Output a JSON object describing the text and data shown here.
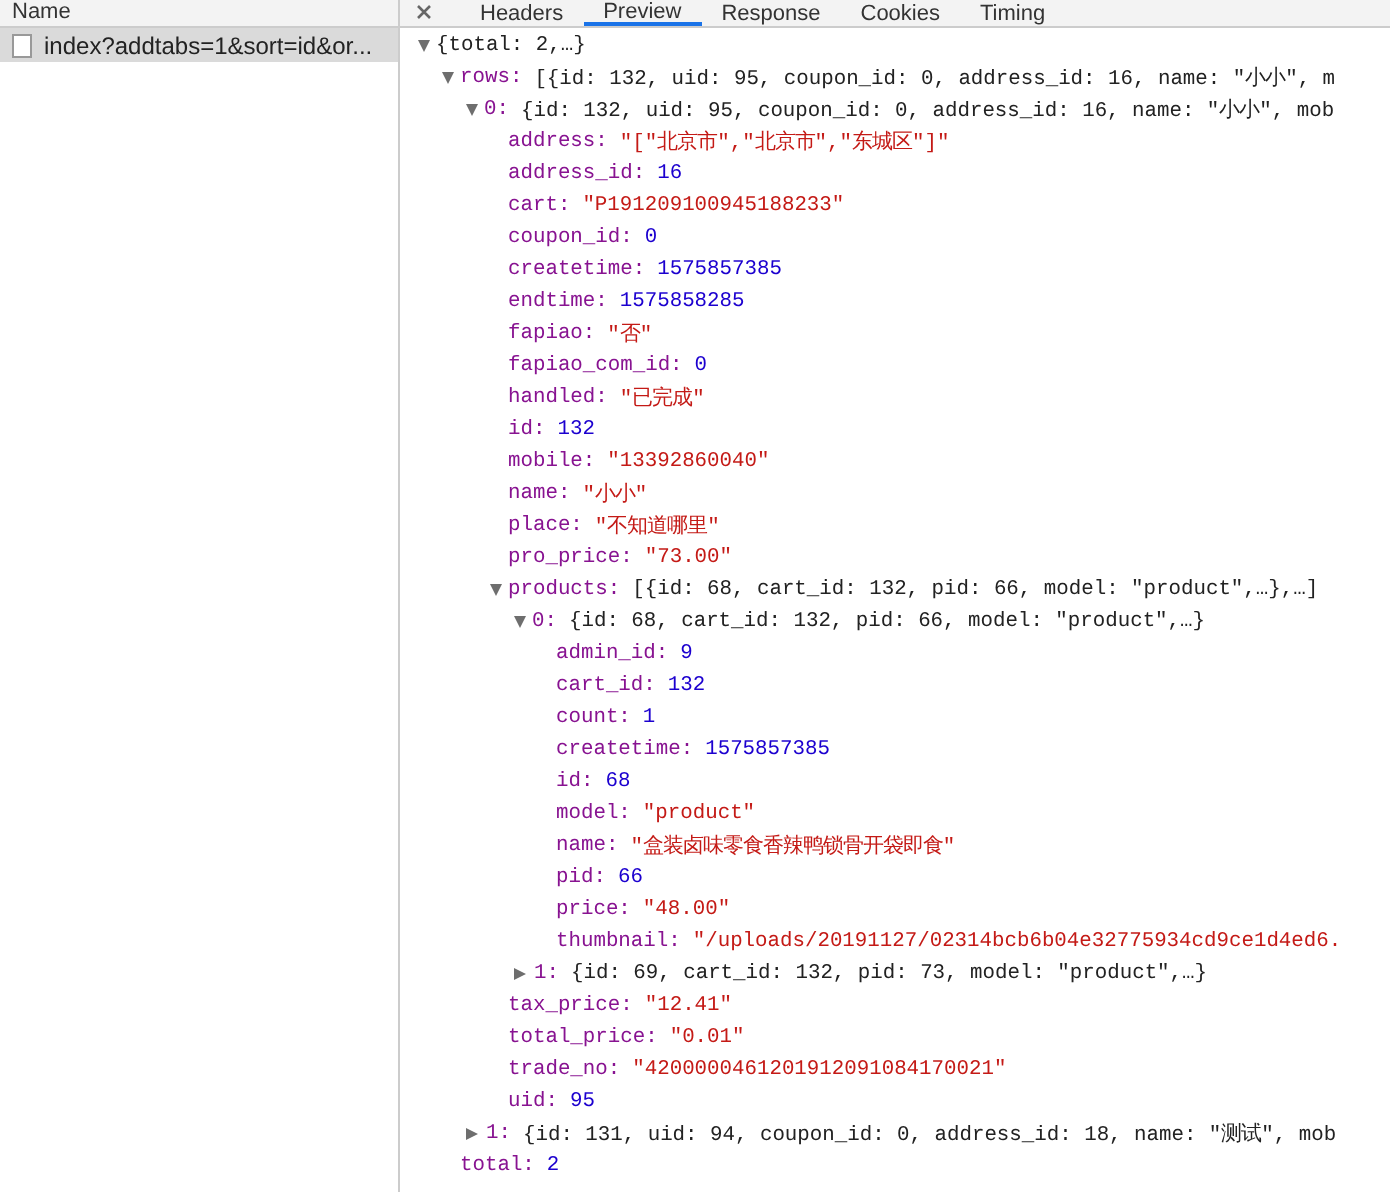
{
  "requests": {
    "header": "Name",
    "items": [
      {
        "label": "index?addtabs=1&sort=id&or...",
        "selected": true
      }
    ]
  },
  "tabs": [
    {
      "label": "Headers",
      "selected": false
    },
    {
      "label": "Preview",
      "selected": true
    },
    {
      "label": "Response",
      "selected": false
    },
    {
      "label": "Cookies",
      "selected": false
    },
    {
      "label": "Timing",
      "selected": false
    }
  ],
  "tree": {
    "value": "{total: 2,…}",
    "kind": "summary",
    "expanded": true,
    "children": [
      {
        "key": "rows:",
        "value": "[{id: 132, uid: 95, coupon_id: 0, address_id: 16, name: \"小小\", m",
        "kind": "summary",
        "expanded": true,
        "children": [
          {
            "key": "0:",
            "value": "{id: 132, uid: 95, coupon_id: 0, address_id: 16, name: \"小小\", mob",
            "kind": "summary",
            "expanded": true,
            "children": [
              {
                "key": "address:",
                "value": "\"[\"北京市\",\"北京市\",\"东城区\"]\"",
                "kind": "string"
              },
              {
                "key": "address_id:",
                "value": "16",
                "kind": "number"
              },
              {
                "key": "cart:",
                "value": "\"P191209100945188233\"",
                "kind": "string"
              },
              {
                "key": "coupon_id:",
                "value": "0",
                "kind": "number"
              },
              {
                "key": "createtime:",
                "value": "1575857385",
                "kind": "number"
              },
              {
                "key": "endtime:",
                "value": "1575858285",
                "kind": "number"
              },
              {
                "key": "fapiao:",
                "value": "\"否\"",
                "kind": "string"
              },
              {
                "key": "fapiao_com_id:",
                "value": "0",
                "kind": "number"
              },
              {
                "key": "handled:",
                "value": "\"已完成\"",
                "kind": "string"
              },
              {
                "key": "id:",
                "value": "132",
                "kind": "number"
              },
              {
                "key": "mobile:",
                "value": "\"13392860040\"",
                "kind": "string"
              },
              {
                "key": "name:",
                "value": "\"小小\"",
                "kind": "string"
              },
              {
                "key": "place:",
                "value": "\"不知道哪里\"",
                "kind": "string"
              },
              {
                "key": "pro_price:",
                "value": "\"73.00\"",
                "kind": "string"
              },
              {
                "key": "products:",
                "value": "[{id: 68, cart_id: 132, pid: 66, model: \"product\",…},…]",
                "kind": "summary",
                "expanded": true,
                "children": [
                  {
                    "key": "0:",
                    "value": "{id: 68, cart_id: 132, pid: 66, model: \"product\",…}",
                    "kind": "summary",
                    "expanded": true,
                    "children": [
                      {
                        "key": "admin_id:",
                        "value": "9",
                        "kind": "number"
                      },
                      {
                        "key": "cart_id:",
                        "value": "132",
                        "kind": "number"
                      },
                      {
                        "key": "count:",
                        "value": "1",
                        "kind": "number"
                      },
                      {
                        "key": "createtime:",
                        "value": "1575857385",
                        "kind": "number"
                      },
                      {
                        "key": "id:",
                        "value": "68",
                        "kind": "number"
                      },
                      {
                        "key": "model:",
                        "value": "\"product\"",
                        "kind": "string"
                      },
                      {
                        "key": "name:",
                        "value": "\"盒装卤味零食香辣鸭锁骨开袋即食\"",
                        "kind": "string"
                      },
                      {
                        "key": "pid:",
                        "value": "66",
                        "kind": "number"
                      },
                      {
                        "key": "price:",
                        "value": "\"48.00\"",
                        "kind": "string"
                      },
                      {
                        "key": "thumbnail:",
                        "value": "\"/uploads/20191127/02314bcb6b04e32775934cd9ce1d4ed6.",
                        "kind": "string"
                      }
                    ]
                  },
                  {
                    "key": "1:",
                    "value": "{id: 69, cart_id: 132, pid: 73, model: \"product\",…}",
                    "kind": "summary",
                    "expanded": false
                  }
                ]
              },
              {
                "key": "tax_price:",
                "value": "\"12.41\"",
                "kind": "string"
              },
              {
                "key": "total_price:",
                "value": "\"0.01\"",
                "kind": "string"
              },
              {
                "key": "trade_no:",
                "value": "\"4200000461201912091084170021\"",
                "kind": "string"
              },
              {
                "key": "uid:",
                "value": "95",
                "kind": "number"
              }
            ]
          },
          {
            "key": "1:",
            "value": "{id: 131, uid: 94, coupon_id: 0, address_id: 18, name: \"测试\", mob",
            "kind": "summary",
            "expanded": false
          }
        ]
      },
      {
        "key": "total:",
        "value": "2",
        "kind": "number"
      }
    ]
  }
}
